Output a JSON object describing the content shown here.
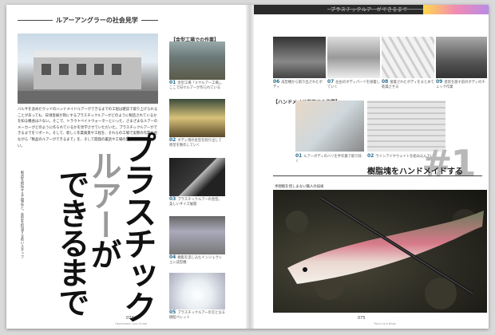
{
  "header": {
    "running_title": "プラスチックルアーができるまで",
    "series_title": "ルアーアングラーの社会見学"
  },
  "lead": {
    "title_line1": "プラスチック",
    "title_line2_highlight": "ルアー",
    "title_line2_rest": "が",
    "title_line3": "できるまで",
    "body": "バルサを含めたウッドのハンドメイドルアーができるまでの工程は雑誌で取り上げられることがあっても、日頃皆様が目にするプラスチックルアーがどのように製造されているかを知る機会は少ない。そこで、トラウトベイトウォーターといった、さまざまなルアーのメーカーがどのように作られているかを見学させていただいた。プラスチックルアーができるまでをリポート。そして、新しく作業風景や工程を、それらの工場で実際の作業を見ながら「製品のルアーができるまで」を、そして開発の裏話や工場の雰囲気も紹介したい。",
    "side_caption": "製造を統括する工場長と、金型を担当する若いスタッフ"
  },
  "factory_section": {
    "title": "【金型工場での作業】",
    "steps": [
      {
        "num": "01",
        "caption": "金型工場「ミヤルアー工場」。ここで日々ルアーが作られている"
      },
      {
        "num": "02",
        "caption": "ボディ用の金型を削り出して原型を製作していく"
      },
      {
        "num": "03",
        "caption": "プラスチックルアーの金型。美しいサイズ展開"
      },
      {
        "num": "04",
        "caption": "樹脂を流し込むインジェクション成型機"
      },
      {
        "num": "05",
        "caption": "プラスチックルアーの元となる樹脂ペレット"
      }
    ]
  },
  "process_top": [
    {
      "num": "06",
      "caption": "成型機から取り出されたボディ"
    },
    {
      "num": "07",
      "caption": "左右のボディパーツを接着していく"
    },
    {
      "num": "08",
      "caption": "接着されたボディをまとめて乾燥させる"
    },
    {
      "num": "09",
      "caption": "塗装を施す前のボディのチェック作業"
    }
  ],
  "process_mid": {
    "title": "【ハンドメイド工房での作業】",
    "steps": [
      {
        "num": "01",
        "caption": "ルアーボディのバリを手作業で取り除く"
      },
      {
        "num": "02",
        "caption": "ラインアイやウェイトを組み込んでいく"
      }
    ]
  },
  "section2": {
    "title": "樹脂塊をハンドメイドする",
    "number": "#1",
    "subcaption": "手間暇を惜しまない職人の技術"
  },
  "folios": {
    "left": "074",
    "left_sub": "Handmade Lure Guide",
    "right": "075",
    "right_sub": "Trout Lure Book"
  },
  "colors": {
    "accent": "#2a6b8a",
    "headline": "#111111",
    "highlight": "#9a9a9a"
  }
}
